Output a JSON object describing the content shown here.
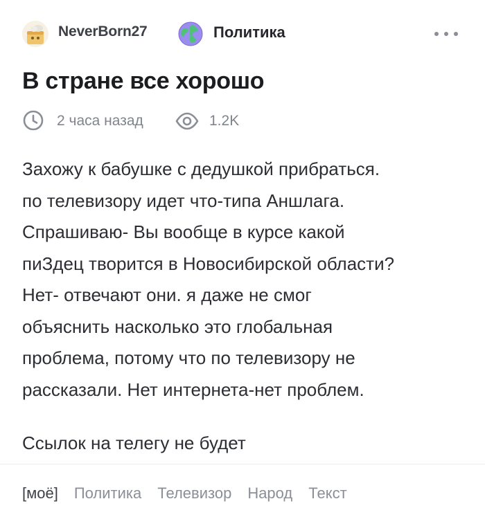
{
  "post": {
    "author": "NeverBorn27",
    "community": "Политика",
    "title": "В стране все хорошо",
    "time": "2 часа назад",
    "views": "1.2K",
    "paragraphs": [
      "Захожу к бабушке с дедушкой прибраться.",
      "по телевизору идет что-типа Аншлага.",
      "Спрашиваю- Вы вообще в курсе какой",
      "пиЗдец творится в Новосибирской области?",
      "Нет- отвечают они. я даже не смог",
      "объяснить насколько это глобальная",
      "проблема, потому что по телевизору не",
      "рассказали. Нет интернета-нет проблем."
    ],
    "closing": "Ссылок на телегу не будет",
    "tags": [
      "[моё]",
      "Политика",
      "Телевизор",
      "Народ",
      "Текст"
    ]
  },
  "icons": {
    "avatar": "user-avatar",
    "community": "globe-icon",
    "more": "more-dots-icon",
    "time": "clock-icon",
    "views": "eye-icon"
  }
}
